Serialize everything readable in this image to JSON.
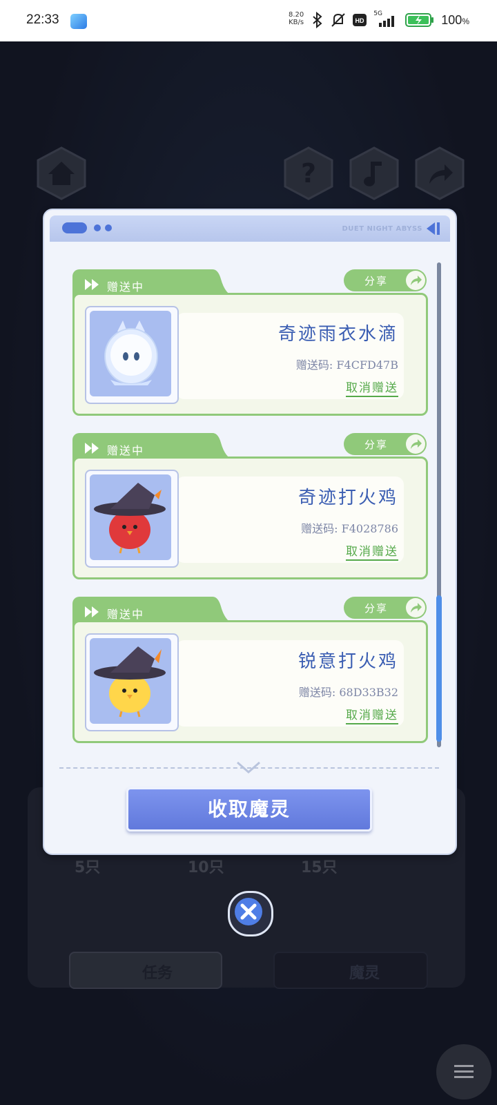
{
  "status_bar": {
    "time": "22:33",
    "net_speed_value": "8.20",
    "net_speed_unit": "KB/s",
    "network": "5G",
    "battery": "100",
    "battery_unit": "%"
  },
  "background": {
    "milestones": [
      "5只",
      "10只",
      "15只"
    ],
    "task_label": "任务",
    "spirit_label": "魔灵"
  },
  "modal": {
    "brand_text": "DUET NIGHT ABYSS",
    "collect_label": "收取魔灵",
    "cards": [
      {
        "status": "赠送中",
        "share_label": "分享",
        "name": "奇迹雨衣水滴",
        "code_label": "赠送码:",
        "code": "F4CFD47B",
        "cancel_label": "取消赠送",
        "icon": "water-drop-creature-icon"
      },
      {
        "status": "赠送中",
        "share_label": "分享",
        "name": "奇迹打火鸡",
        "code_label": "赠送码:",
        "code": "F4028786",
        "cancel_label": "取消赠送",
        "icon": "red-witch-chick-icon"
      },
      {
        "status": "赠送中",
        "share_label": "分享",
        "name": "锐意打火鸡",
        "code_label": "赠送码:",
        "code": "68D33B32",
        "cancel_label": "取消赠送",
        "icon": "yellow-witch-chick-icon"
      }
    ]
  },
  "colors": {
    "accent_green": "#90c97a",
    "name_blue": "#3a5db2",
    "button_blue": "#6f86e6"
  }
}
